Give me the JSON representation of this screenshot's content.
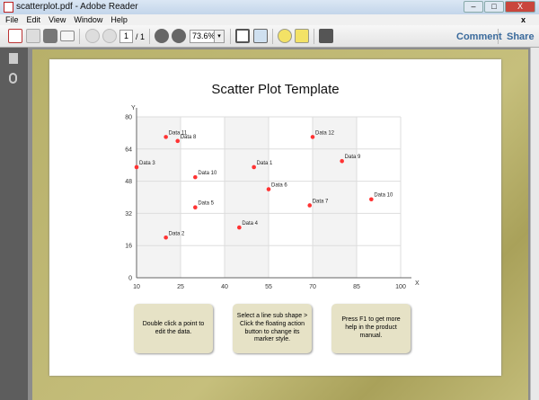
{
  "window": {
    "title": "scatterplot.pdf - Adobe Reader",
    "min": "–",
    "max": "□",
    "close": "X"
  },
  "menu": [
    "File",
    "Edit",
    "View",
    "Window",
    "Help"
  ],
  "menu_close": "x",
  "toolbar": {
    "page": "1",
    "page_total": "/ 1",
    "zoom": "73.6%",
    "dropdown": "▾",
    "comment": "Comment",
    "share": "Share"
  },
  "document": {
    "title": "Scatter Plot Template",
    "notes": [
      "Double click a point to edit the data.",
      "Select a line sub shape > Click the floating action button to change its marker style.",
      "Press F1 to get more help in the product manual."
    ]
  },
  "chart_data": {
    "type": "scatter",
    "title": "Scatter Plot Template",
    "xlabel": "X",
    "ylabel": "Y",
    "xlim": [
      10,
      100
    ],
    "ylim": [
      0,
      80
    ],
    "xticks": [
      10,
      25,
      40,
      55,
      70,
      85,
      100
    ],
    "yticks": [
      0,
      16,
      32,
      48,
      64,
      80
    ],
    "grid": true,
    "color": "#ff3333",
    "points": [
      {
        "label": "Data 1",
        "x": 50,
        "y": 55
      },
      {
        "label": "Data 2",
        "x": 20,
        "y": 20
      },
      {
        "label": "Data 3",
        "x": 10,
        "y": 55
      },
      {
        "label": "Data 4",
        "x": 45,
        "y": 25
      },
      {
        "label": "Data 5",
        "x": 30,
        "y": 35
      },
      {
        "label": "Data 6",
        "x": 55,
        "y": 44
      },
      {
        "label": "Data 7",
        "x": 69,
        "y": 36
      },
      {
        "label": "Data 8",
        "x": 24,
        "y": 68
      },
      {
        "label": "Data 9",
        "x": 80,
        "y": 58
      },
      {
        "label": "Data 10",
        "x": 30,
        "y": 50
      },
      {
        "label": "Data 10",
        "x": 90,
        "y": 39
      },
      {
        "label": "Data 11",
        "x": 20,
        "y": 70
      },
      {
        "label": "Data 12",
        "x": 70,
        "y": 70
      }
    ]
  }
}
